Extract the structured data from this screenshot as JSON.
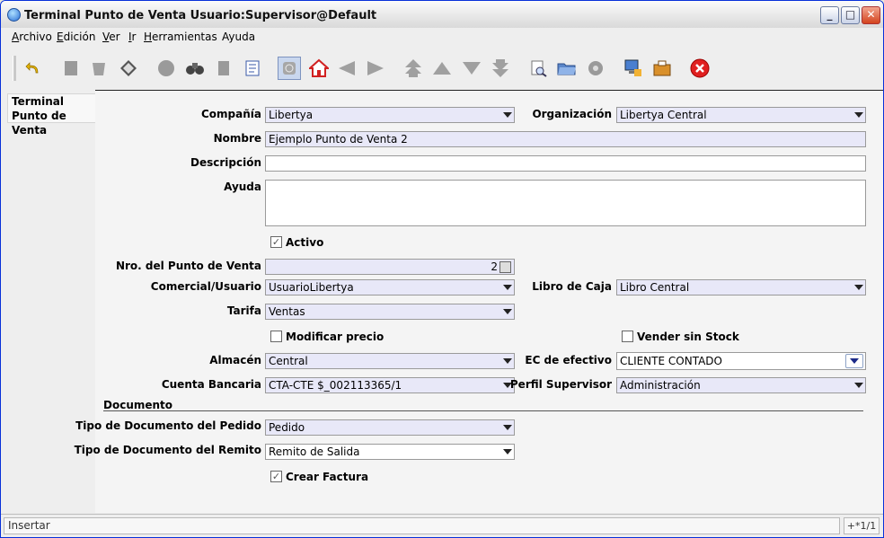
{
  "window": {
    "title": "Terminal Punto de Venta   Usuario:Supervisor@Default"
  },
  "menubar": {
    "items": [
      {
        "key": "A",
        "rest": "rchivo"
      },
      {
        "key": "E",
        "rest": "dición"
      },
      {
        "key": "V",
        "rest": "er"
      },
      {
        "key": "I",
        "rest": "r"
      },
      {
        "key": "H",
        "rest": "erramientas"
      },
      {
        "key": "",
        "rest": "Ayuda"
      }
    ]
  },
  "toolbar": {
    "icons": [
      "undo-icon",
      "new-record-icon",
      "delete-icon",
      "save-icon",
      "refresh-icon",
      "find-icon",
      "history-icon",
      "grid-toggle-icon",
      "attachment-icon",
      "home-icon",
      "previous-icon",
      "next-icon",
      "first-record-icon",
      "previous-record-icon",
      "next-record-icon",
      "last-record-icon",
      "report-icon",
      "archive-icon",
      "zoom-across-icon",
      "process-icon",
      "print-icon",
      "exit-icon"
    ]
  },
  "tabs": {
    "active_label_line1": "Terminal",
    "active_label_line2": "Punto de Venta"
  },
  "form": {
    "compania": {
      "label": "Compañía",
      "value": "Libertya"
    },
    "organizacion": {
      "label": "Organización",
      "value": "Libertya Central"
    },
    "nombre": {
      "label": "Nombre",
      "value": "Ejemplo Punto de Venta 2"
    },
    "descripcion": {
      "label": "Descripción",
      "value": ""
    },
    "ayuda": {
      "label": "Ayuda",
      "value": ""
    },
    "activo": {
      "label": "Activo",
      "checked": true
    },
    "nro_punto_venta": {
      "label": "Nro. del Punto de Venta",
      "value": "2"
    },
    "comercial": {
      "label": "Comercial/Usuario",
      "value": "UsuarioLibertya"
    },
    "libro_caja": {
      "label": "Libro de Caja",
      "value": "Libro Central"
    },
    "tarifa": {
      "label": "Tarifa",
      "value": "Ventas"
    },
    "modificar_precio": {
      "label": "Modificar precio",
      "checked": false
    },
    "vender_sin_stock": {
      "label": "Vender sin Stock",
      "checked": false
    },
    "almacen": {
      "label": "Almacén",
      "value": "Central"
    },
    "ec_efectivo": {
      "label": "EC de efectivo",
      "value": "CLIENTE CONTADO"
    },
    "cuenta_bancaria": {
      "label": "Cuenta Bancaria",
      "value": "CTA-CTE $_002113365/1"
    },
    "perfil_supervisor": {
      "label": "Perfil Supervisor",
      "value": "Administración"
    },
    "documento_section": "Documento",
    "tipo_doc_pedido": {
      "label": "Tipo de Documento del Pedido",
      "value": "Pedido"
    },
    "tipo_doc_remito": {
      "label": "Tipo de Documento del Remito",
      "value": "Remito de Salida"
    },
    "crear_factura": {
      "label": "Crear Factura",
      "checked": true
    }
  },
  "status": {
    "message": "Insertar",
    "record": "+*1/1"
  }
}
